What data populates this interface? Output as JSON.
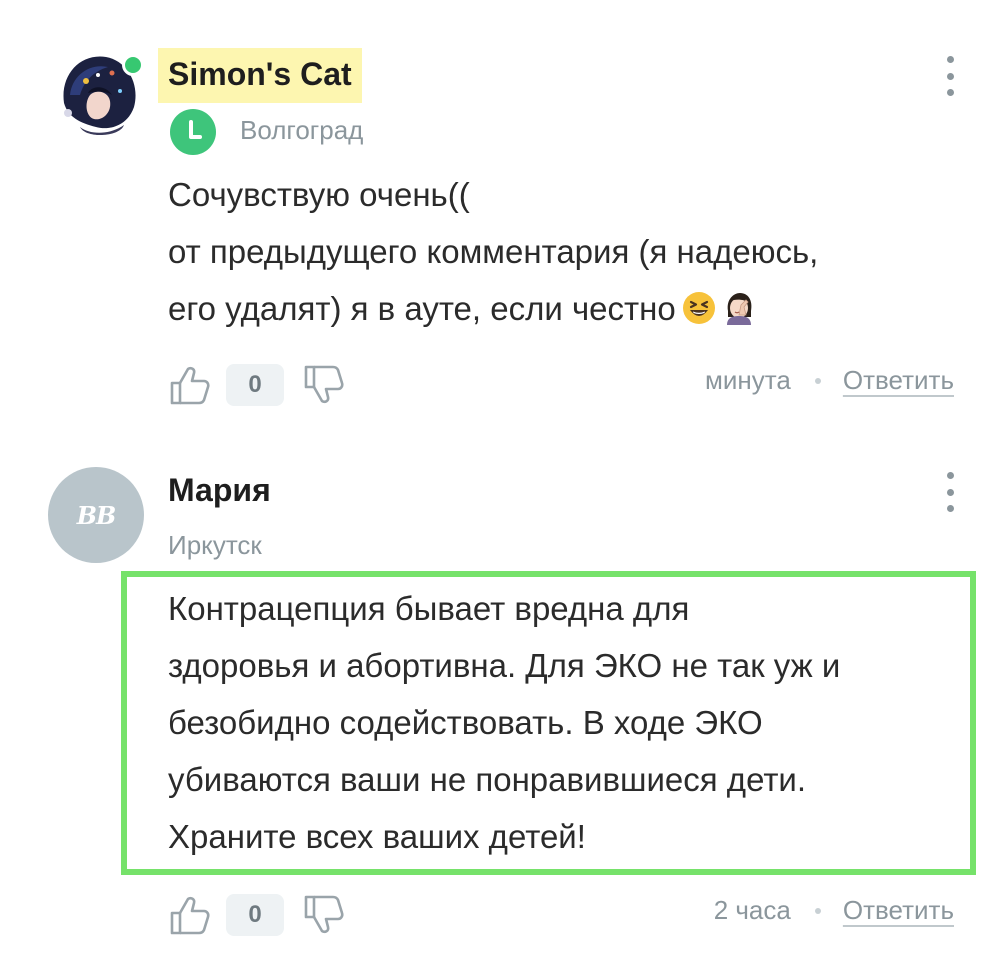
{
  "comments": [
    {
      "author": "Simon's Cat",
      "city": "Волгоград",
      "lines": [
        "Сочувствую очень((",
        "от предыдущего комментария (я надеюсь,",
        "его удалят) я в ауте, если честно"
      ],
      "likes": "0",
      "time": "минута",
      "reply": "Ответить"
    },
    {
      "author": "Мария",
      "avatar_initials": "BB",
      "city": "Иркутск",
      "lines": [
        "Контрацепция бывает вредна для",
        "здоровья и абортивна. Для ЭКО не так уж и",
        "безобидно содействовать. В ходе ЭКО",
        "убиваются ваши не понравившиеся дети.",
        "Храните всех ваших детей!"
      ],
      "likes": "0",
      "time": "2 часа",
      "reply": "Ответить"
    }
  ],
  "colors": {
    "highlight_border": "#76e26a",
    "author_highlight": "#fdf6b0",
    "online": "#37c871",
    "muted": "#8b969c"
  },
  "icons": [
    "kebab-menu-icon",
    "clock-badge-icon",
    "thumb-up-icon",
    "thumb-down-icon",
    "grinning-squinting-emoji",
    "facepalm-emoji"
  ]
}
